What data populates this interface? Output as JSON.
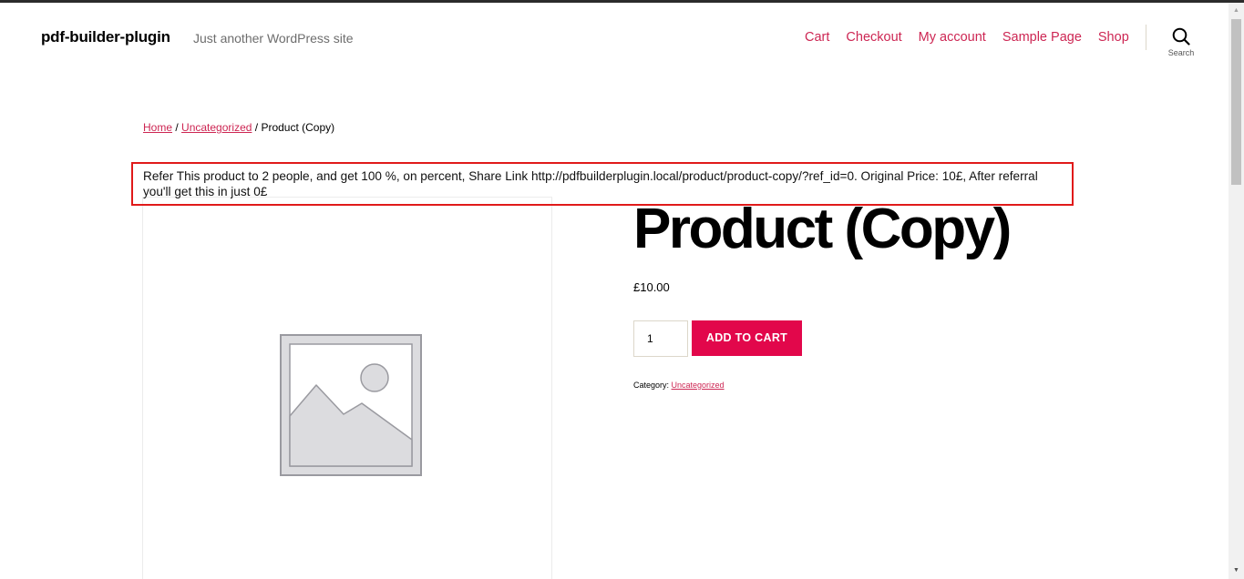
{
  "header": {
    "site_title": "pdf-builder-plugin",
    "site_description": "Just another WordPress site",
    "nav": [
      "Cart",
      "Checkout",
      "My account",
      "Sample Page",
      "Shop"
    ],
    "search_label": "Search"
  },
  "breadcrumb": {
    "home": "Home",
    "separator1": " / ",
    "category": "Uncategorized",
    "separator2": " / ",
    "current": "Product (Copy)"
  },
  "referral_notice": "Refer This product to 2 people, and get 100 %, on percent, Share Link http://pdfbuilderplugin.local/product/product-copy/?ref_id=0. Original Price: 10£, After referral you'll get this in just 0£",
  "product": {
    "title": "Product (Copy)",
    "price": "£10.00",
    "quantity": "1",
    "add_to_cart_label": "ADD TO CART",
    "category_label": "Category: ",
    "category_value": "Uncategorized"
  },
  "colors": {
    "accent": "#cd2653",
    "button": "#e2074b",
    "highlight_border": "#e01a1a"
  }
}
